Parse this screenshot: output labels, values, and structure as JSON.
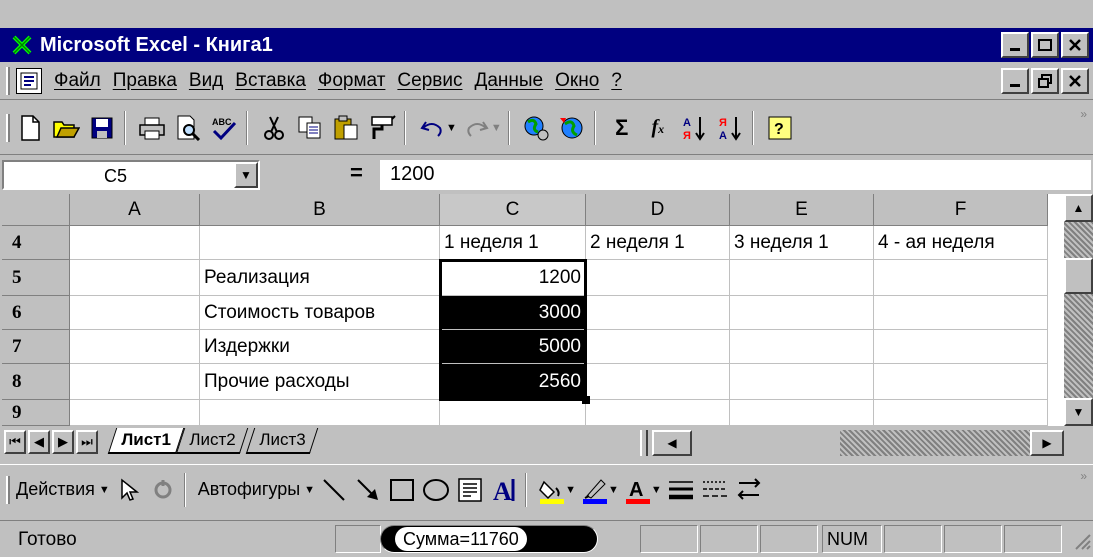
{
  "window": {
    "title": "Microsoft Excel - Книга1"
  },
  "menu": [
    {
      "label": "Файл"
    },
    {
      "label": "Правка"
    },
    {
      "label": "Вид"
    },
    {
      "label": "Вставка"
    },
    {
      "label": "Формат"
    },
    {
      "label": "Сервис"
    },
    {
      "label": "Данные"
    },
    {
      "label": "Окно"
    },
    {
      "label": "?"
    }
  ],
  "formula_bar": {
    "cell_ref": "C5",
    "equals": "=",
    "value": "1200"
  },
  "grid": {
    "columns": [
      "A",
      "B",
      "C",
      "D",
      "E",
      "F"
    ],
    "rows": [
      "4",
      "5",
      "6",
      "7",
      "8",
      "9"
    ],
    "cells": {
      "C4": "1 неделя 1",
      "D4": "2 неделя 1",
      "E4": "3 неделя 1",
      "F4": "4 - ая неделя",
      "B5": "Реализация",
      "C5": "1200",
      "B6": "Стоимость товаров",
      "C6": "3000",
      "B7": "Издержки",
      "C7": "5000",
      "B8": "Прочие расходы",
      "C8": "2560"
    }
  },
  "sheets": [
    {
      "label": "Лист1",
      "active": true
    },
    {
      "label": "Лист2",
      "active": false
    },
    {
      "label": "Лист3",
      "active": false
    }
  ],
  "drawing_toolbar": {
    "actions_label": "Действия",
    "autoshapes_label": "Автофигуры"
  },
  "status": {
    "ready": "Готово",
    "sum": "Сумма=11760",
    "num": "NUM"
  },
  "colors": {
    "title_bar": "#000080",
    "face": "#c0c0c0",
    "selection": "#000000"
  }
}
